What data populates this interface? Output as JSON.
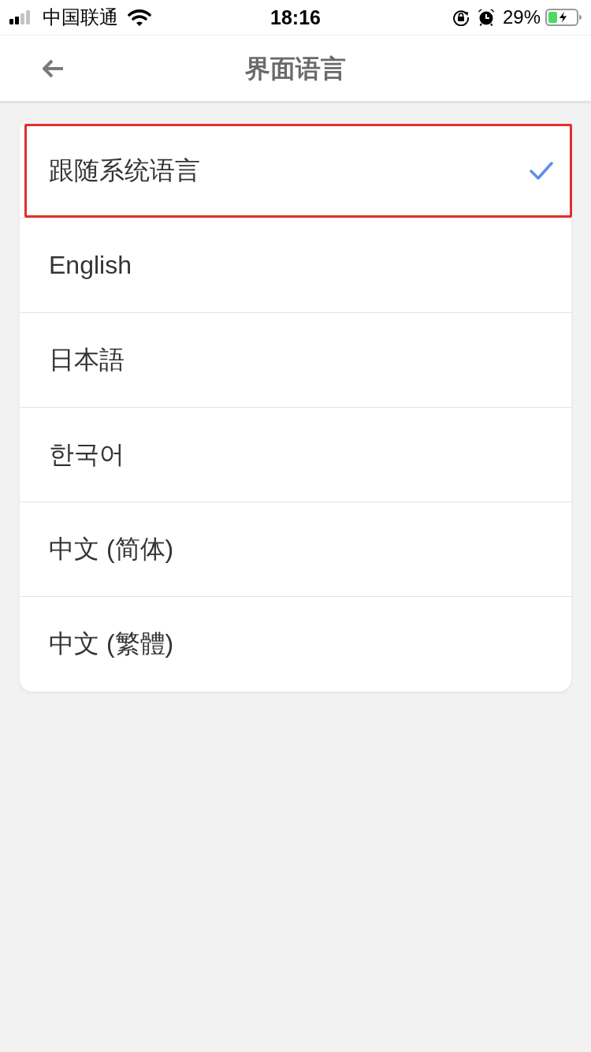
{
  "status_bar": {
    "carrier": "中国联通",
    "time": "18:16",
    "battery_percent": "29%"
  },
  "header": {
    "title": "界面语言"
  },
  "languages": [
    {
      "label": "跟随系统语言",
      "selected": true,
      "highlighted": true
    },
    {
      "label": "English",
      "selected": false,
      "highlighted": false
    },
    {
      "label": "日本語",
      "selected": false,
      "highlighted": false
    },
    {
      "label": "한국어",
      "selected": false,
      "highlighted": false
    },
    {
      "label": "中文 (简体)",
      "selected": false,
      "highlighted": false
    },
    {
      "label": "中文 (繁體)",
      "selected": false,
      "highlighted": false
    }
  ]
}
